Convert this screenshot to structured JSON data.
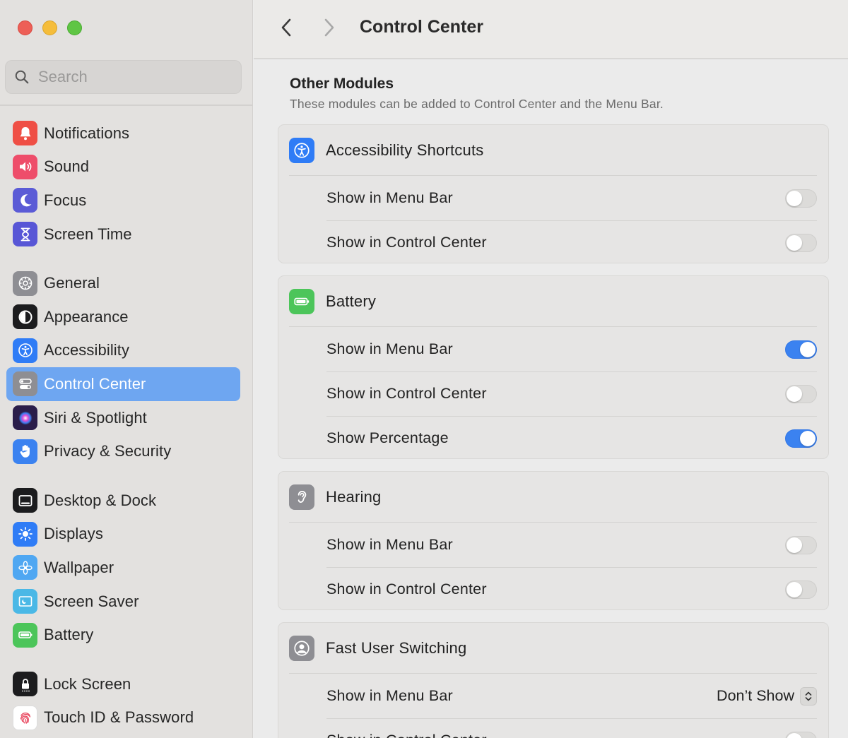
{
  "search": {
    "placeholder": "Search"
  },
  "sidebar": {
    "items": [
      {
        "label": "Notifications",
        "icon": "bell-icon",
        "color": "#ef4f45"
      },
      {
        "label": "Sound",
        "icon": "speaker-icon",
        "color": "#ee4d6a"
      },
      {
        "label": "Focus",
        "icon": "moon-icon",
        "color": "#5b5bd6"
      },
      {
        "label": "Screen Time",
        "icon": "hourglass-icon",
        "color": "#5856d6"
      },
      {
        "label": "General",
        "icon": "gear-icon",
        "color": "#8e8e93"
      },
      {
        "label": "Appearance",
        "icon": "appearance-icon",
        "color": "#1c1c1e"
      },
      {
        "label": "Accessibility",
        "icon": "accessibility-icon",
        "color": "#2f7cf6"
      },
      {
        "label": "Control Center",
        "icon": "control-center-icon",
        "color": "#8e8e93",
        "selected": true
      },
      {
        "label": "Siri & Spotlight",
        "icon": "siri-icon",
        "color": "#3a2a6a"
      },
      {
        "label": "Privacy & Security",
        "icon": "hand-icon",
        "color": "#3b82f0"
      },
      {
        "label": "Desktop & Dock",
        "icon": "dock-icon",
        "color": "#1c1c1e"
      },
      {
        "label": "Displays",
        "icon": "sun-icon",
        "color": "#2f7cf6"
      },
      {
        "label": "Wallpaper",
        "icon": "flower-icon",
        "color": "#4fa7f2"
      },
      {
        "label": "Screen Saver",
        "icon": "screensaver-icon",
        "color": "#4ab8e6"
      },
      {
        "label": "Battery",
        "icon": "battery-icon",
        "color": "#4cc55a"
      },
      {
        "label": "Lock Screen",
        "icon": "lock-icon",
        "color": "#1c1c1e"
      },
      {
        "label": "Touch ID & Password",
        "icon": "fingerprint-icon",
        "color": "#ffffff"
      }
    ]
  },
  "toolbar": {
    "title": "Control Center"
  },
  "section": {
    "title": "Other Modules",
    "subtitle": "These modules can be added to Control Center and the Menu Bar."
  },
  "modules": [
    {
      "title": "Accessibility Shortcuts",
      "icon": "accessibility-icon",
      "rows": [
        {
          "label": "Show in Menu Bar",
          "on": false
        },
        {
          "label": "Show in Control Center",
          "on": false
        }
      ]
    },
    {
      "title": "Battery",
      "icon": "battery-icon",
      "rows": [
        {
          "label": "Show in Menu Bar",
          "on": true
        },
        {
          "label": "Show in Control Center",
          "on": false
        },
        {
          "label": "Show Percentage",
          "on": true
        }
      ]
    },
    {
      "title": "Hearing",
      "icon": "ear-icon",
      "rows": [
        {
          "label": "Show in Menu Bar",
          "on": false
        },
        {
          "label": "Show in Control Center",
          "on": false
        }
      ]
    },
    {
      "title": "Fast User Switching",
      "icon": "user-icon",
      "rows": [
        {
          "label": "Show in Menu Bar",
          "value": "Don’t Show"
        },
        {
          "label": "Show in Control Center",
          "on": false
        }
      ]
    }
  ]
}
